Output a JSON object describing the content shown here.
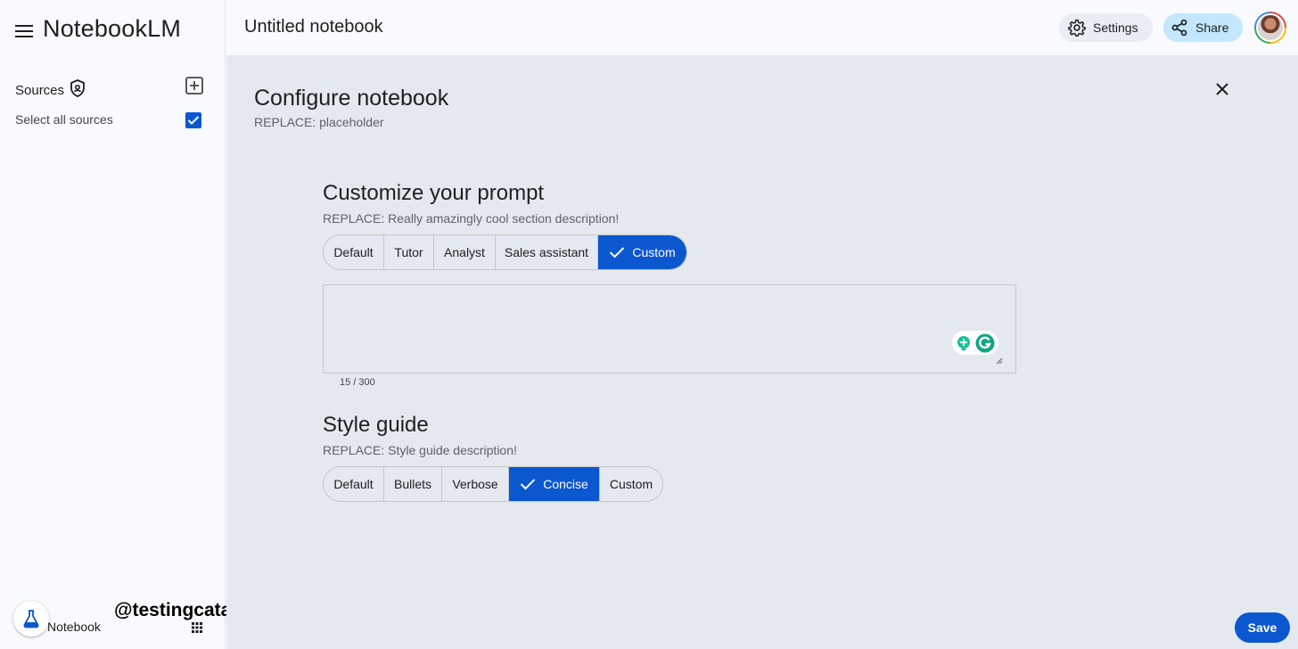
{
  "app": {
    "title": "NotebookLM"
  },
  "sidebar": {
    "sources_label": "Sources",
    "select_all_label": "Select all sources",
    "select_all_checked": true,
    "footer_label": "Notebook"
  },
  "topbar": {
    "notebook_title": "Untitled notebook",
    "settings_label": "Settings",
    "share_label": "Share"
  },
  "config": {
    "title": "Configure notebook",
    "subtitle": "REPLACE: placeholder",
    "prompt": {
      "title": "Customize your prompt",
      "description": "REPLACE: Really amazingly cool section description!",
      "options": [
        "Default",
        "Tutor",
        "Analyst",
        "Sales assistant",
        "Custom"
      ],
      "selected": "Custom",
      "text_value": "",
      "char_count": "15 / 300"
    },
    "style": {
      "title": "Style guide",
      "description": "REPLACE: Style guide description!",
      "options": [
        "Default",
        "Bullets",
        "Verbose",
        "Concise",
        "Custom"
      ],
      "selected": "Concise"
    },
    "save_label": "Save"
  },
  "watermark": "@testingcatalog",
  "colors": {
    "accent": "#0b57d0",
    "share_bg": "#c2e7ff",
    "panel_bg": "#e4e8ef"
  }
}
